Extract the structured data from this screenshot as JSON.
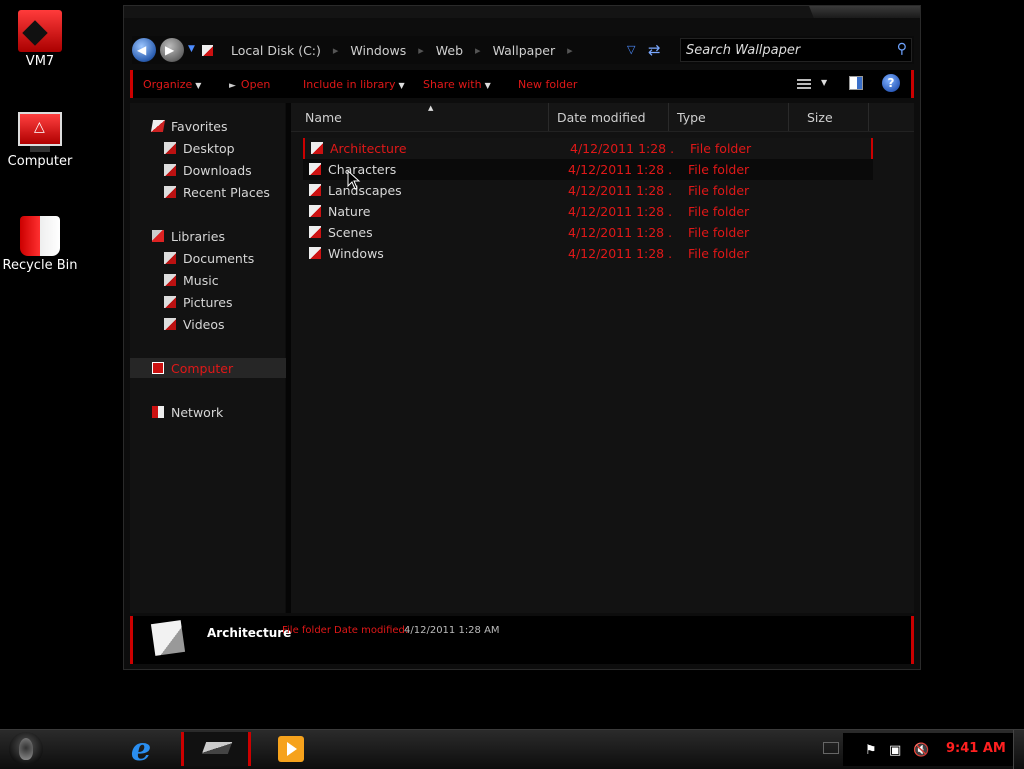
{
  "desktop": {
    "icons": [
      {
        "label": "VM7"
      },
      {
        "label": "Computer"
      },
      {
        "label": "Recycle Bin"
      }
    ]
  },
  "address": {
    "crumbs": [
      "Local Disk (C:)",
      "Windows",
      "Web",
      "Wallpaper"
    ],
    "search_placeholder": "Search Wallpaper"
  },
  "toolbar": {
    "organize": "Organize",
    "open": "Open",
    "include_in_library": "Include in library",
    "share_with": "Share with",
    "new_folder": "New folder"
  },
  "nav": {
    "favorites": "Favorites",
    "desktop": "Desktop",
    "downloads": "Downloads",
    "recent_places": "Recent Places",
    "libraries": "Libraries",
    "documents": "Documents",
    "music": "Music",
    "pictures": "Pictures",
    "videos": "Videos",
    "computer": "Computer",
    "network": "Network"
  },
  "columns": {
    "name": "Name",
    "date_modified": "Date modified",
    "type": "Type",
    "size": "Size"
  },
  "files": [
    {
      "name": "Architecture",
      "date": "4/12/2011 1:28 ...",
      "type": "File folder"
    },
    {
      "name": "Characters",
      "date": "4/12/2011 1:28 ...",
      "type": "File folder"
    },
    {
      "name": "Landscapes",
      "date": "4/12/2011 1:28 ...",
      "type": "File folder"
    },
    {
      "name": "Nature",
      "date": "4/12/2011 1:28 ...",
      "type": "File folder"
    },
    {
      "name": "Scenes",
      "date": "4/12/2011 1:28 ...",
      "type": "File folder"
    },
    {
      "name": "Windows",
      "date": "4/12/2011 1:28 ...",
      "type": "File folder"
    }
  ],
  "details": {
    "name": "Architecture",
    "type": "File folder",
    "date_label": "Date modified:",
    "date_value": "4/12/2011 1:28 AM"
  },
  "taskbar": {
    "clock": "9:41 AM"
  },
  "colors": {
    "accent": "#e01818",
    "background": "#000000",
    "panel": "#121212"
  }
}
